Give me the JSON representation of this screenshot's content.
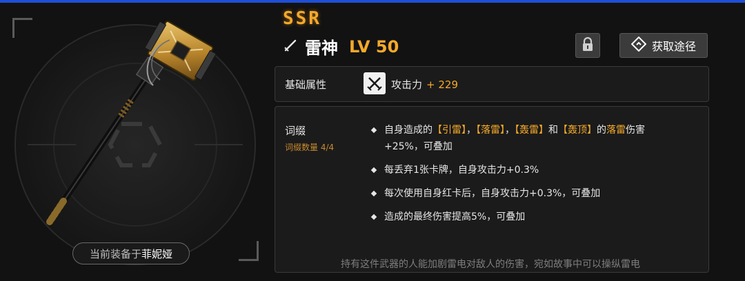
{
  "weapon": {
    "rarity": "SSR",
    "name": "雷神",
    "level": "LV 50",
    "equipped_prefix": "当前装备于",
    "equipped_character": "菲妮娅"
  },
  "actions": {
    "lock_icon": "lock-icon",
    "obtain_label": "获取途径",
    "obtain_icon": "route-icon"
  },
  "base_attributes": {
    "label": "基础属性",
    "stat_name": "攻击力",
    "stat_value": "+ 229",
    "stat_icon": "crossed-swords-icon"
  },
  "affixes": {
    "title": "词缀",
    "count_text": "词缀数量 4/4",
    "effect1": {
      "p1": "自身造成的",
      "k1": "【引雷】",
      "p2": "，",
      "k2": "【落雷】",
      "p3": "，",
      "k3": "【轰雷】",
      "p4": "和",
      "k4": "【轰顶】",
      "p5": "的",
      "k5": "落雷",
      "p6": "伤害+25%，可叠加"
    },
    "effect2": "每丢弃1张卡牌，自身攻击力+0.3%",
    "effect3": "每次使用自身红卡后，自身攻击力+0.3%，可叠加",
    "effect4": "造成的最终伤害提高5%，可叠加",
    "flavor": "持有这件武器的人能加剧雷电对敌人的伤害，宛如故事中可以操纵雷电"
  },
  "colors": {
    "accent": "#f4a92a",
    "top_bar": "#1f4fd6",
    "background": "#121212"
  }
}
